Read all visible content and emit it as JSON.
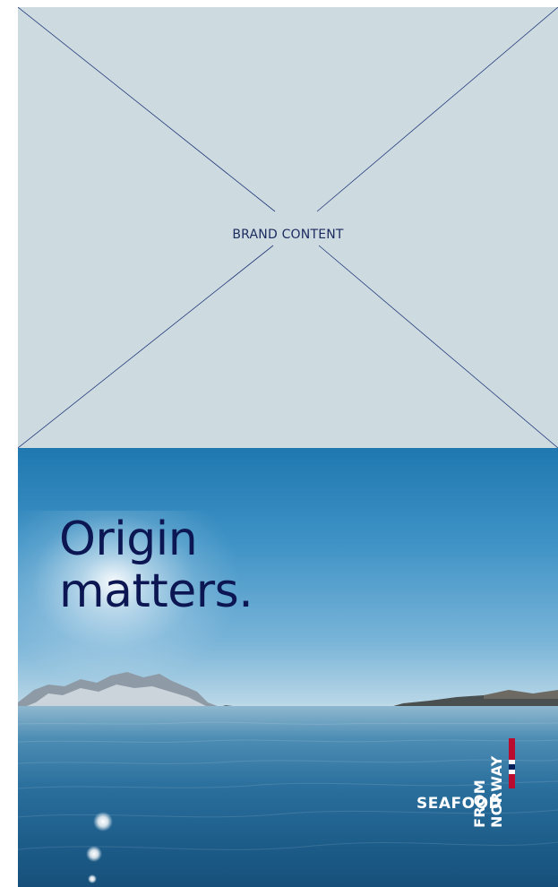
{
  "placeholder": {
    "label": "BRAND CONTENT"
  },
  "hero": {
    "headline_line1": "Origin",
    "headline_line2": "matters."
  },
  "logo": {
    "text_seafood": "SEAFOOD",
    "text_from": "FROM",
    "text_norway": "NORWAY",
    "flag_colors": [
      "#ba0c2f",
      "#ffffff",
      "#00205b"
    ]
  },
  "colors": {
    "placeholder_bg": "#cddbe1",
    "navy": "#0c1652",
    "sky_top": "#1f78b0"
  }
}
